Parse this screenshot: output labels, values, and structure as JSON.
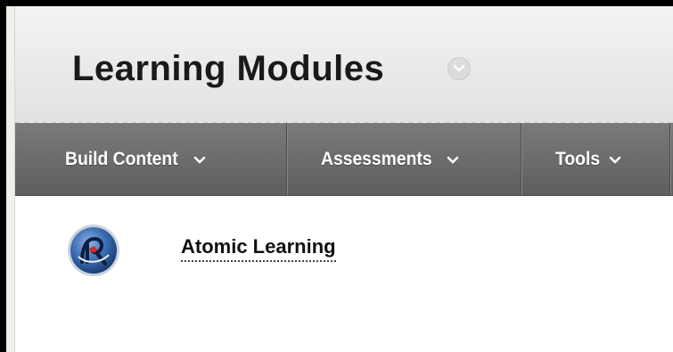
{
  "page": {
    "title": "Learning Modules"
  },
  "action_bar": {
    "items": [
      {
        "label": "Build Content"
      },
      {
        "label": "Assessments"
      },
      {
        "label": "Tools"
      }
    ]
  },
  "content": {
    "items": [
      {
        "title": "Atomic Learning",
        "icon": "atomic-learning-logo"
      }
    ]
  },
  "colors": {
    "action_bar": "#686868",
    "header_bg": "#ececec",
    "title_text": "#1a1a1a"
  }
}
